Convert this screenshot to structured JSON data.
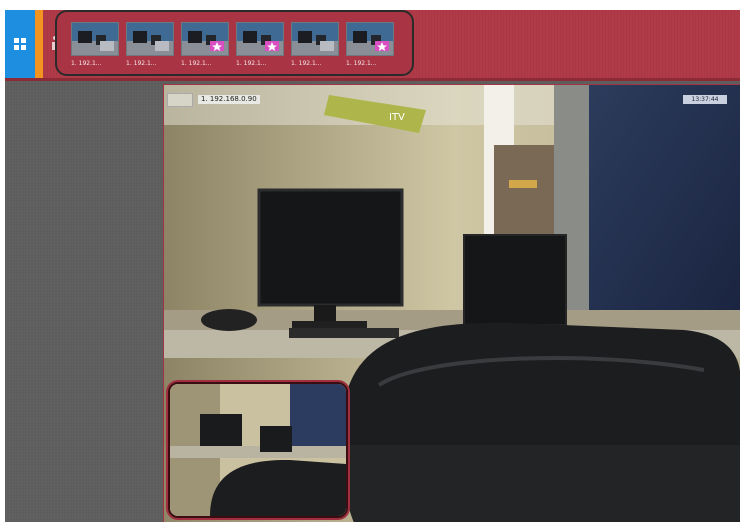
{
  "toolbar": {
    "layout_icon": "grid-icon",
    "grip_icon": "grip-icon",
    "cameras": [
      {
        "label": "1. 192.1...",
        "state": "normal"
      },
      {
        "label": "1. 192.1...",
        "state": "normal"
      },
      {
        "label": "1. 192.1...",
        "state": "favorite"
      },
      {
        "label": "1. 192.1...",
        "state": "favorite"
      },
      {
        "label": "1. 192.1...",
        "state": "normal"
      },
      {
        "label": "1. 192.1...",
        "state": "favorite"
      }
    ]
  },
  "viewer": {
    "camera_label": "1. 192.168.0.90",
    "timestamp": "13:37:44",
    "wall_sign": "ITV"
  },
  "colors": {
    "toolbar_bg": "#b03a48",
    "accent_blue": "#1e8fe0",
    "accent_orange": "#f39421",
    "panel_bg": "#5e5e5e"
  }
}
